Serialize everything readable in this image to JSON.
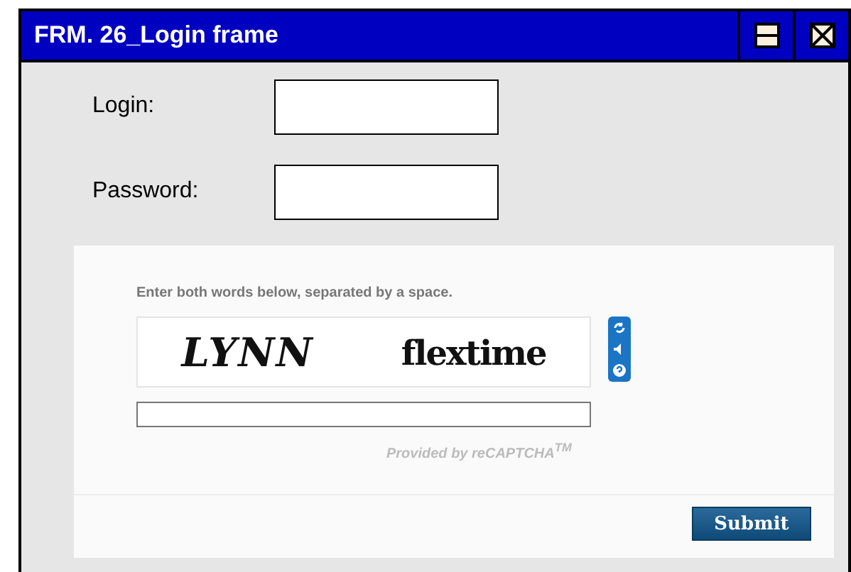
{
  "window": {
    "title": "FRM. 26_Login frame"
  },
  "fields": [
    {
      "label": "Login:"
    },
    {
      "label": "Password:"
    }
  ],
  "captcha": {
    "instruction": "Enter both words below, separated by a space.",
    "words": [
      "LYNN",
      "flextime"
    ],
    "provider": "Provided by reCAPTCHA$^{TM}$",
    "submit": "Submit"
  }
}
